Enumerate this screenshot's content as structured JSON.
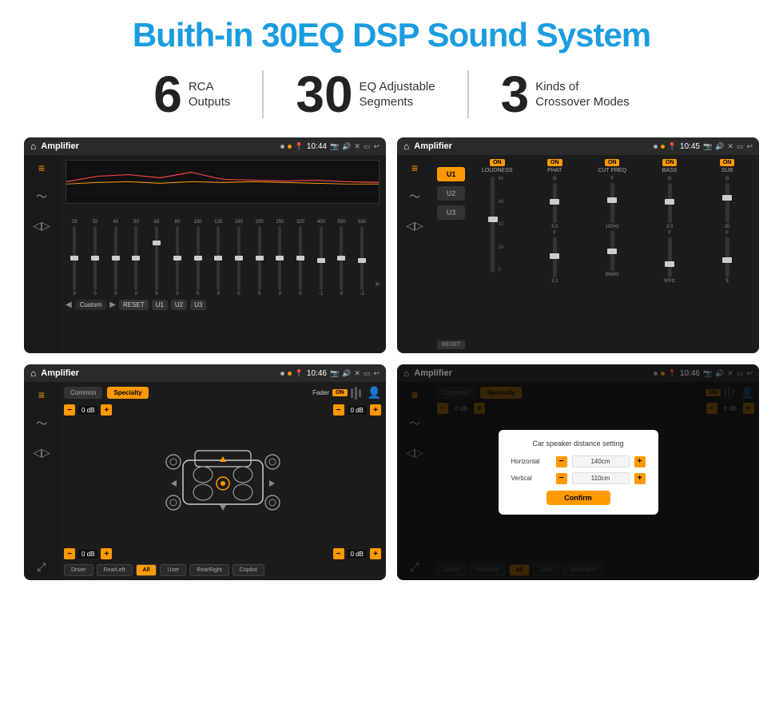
{
  "header": {
    "title": "Buith-in 30EQ DSP Sound System"
  },
  "stats": [
    {
      "number": "6",
      "label": "RCA\nOutputs"
    },
    {
      "number": "30",
      "label": "EQ Adjustable\nSegments"
    },
    {
      "number": "3",
      "label": "Kinds of\nCrossover Modes"
    }
  ],
  "screens": [
    {
      "id": "eq-screen",
      "statusBar": {
        "title": "Amplifier",
        "time": "10:44"
      },
      "type": "equalizer"
    },
    {
      "id": "amp-screen",
      "statusBar": {
        "title": "Amplifier",
        "time": "10:45"
      },
      "type": "amplifier"
    },
    {
      "id": "cross-screen",
      "statusBar": {
        "title": "Amplifier",
        "time": "10:46"
      },
      "type": "crossover"
    },
    {
      "id": "cross-dialog-screen",
      "statusBar": {
        "title": "Amplifier",
        "time": "10:46"
      },
      "type": "crossover-dialog"
    }
  ],
  "eq": {
    "frequencies": [
      "25",
      "32",
      "40",
      "50",
      "63",
      "80",
      "100",
      "125",
      "160",
      "200",
      "250",
      "320",
      "400",
      "500",
      "630"
    ],
    "values": [
      "0",
      "0",
      "0",
      "0",
      "5",
      "0",
      "0",
      "0",
      "0",
      "0",
      "0",
      "0",
      "-1",
      "0",
      "-1"
    ],
    "navItems": [
      "Custom",
      "RESET",
      "U1",
      "U2",
      "U3"
    ]
  },
  "amplifier": {
    "presets": [
      "U1",
      "U2",
      "U3"
    ],
    "controls": [
      {
        "label": "LOUDNESS",
        "on": true
      },
      {
        "label": "PHAT",
        "on": true
      },
      {
        "label": "CUT FREQ",
        "on": true
      },
      {
        "label": "BASS",
        "on": true
      },
      {
        "label": "SUB",
        "on": true
      }
    ]
  },
  "crossover": {
    "tabs": [
      "Common",
      "Specialty"
    ],
    "faderLabel": "Fader",
    "dbValues": [
      "0 dB",
      "0 dB",
      "0 dB",
      "0 dB"
    ],
    "buttons": [
      "Driver",
      "RearLeft",
      "All",
      "User",
      "RearRight",
      "Copilot"
    ]
  },
  "dialog": {
    "title": "Car speaker distance setting",
    "horizontal": {
      "label": "Horizontal",
      "value": "140cm"
    },
    "vertical": {
      "label": "Vertical",
      "value": "110cm"
    },
    "confirm": "Confirm"
  }
}
